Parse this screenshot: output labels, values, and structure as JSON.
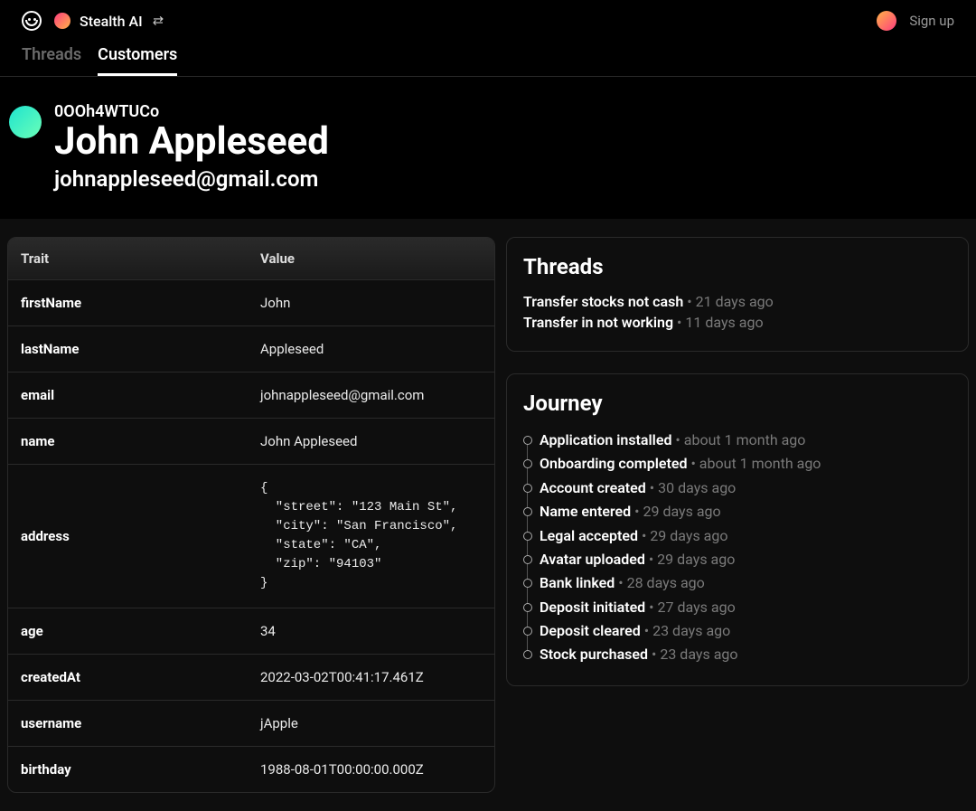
{
  "topbar": {
    "workspace_name": "Stealth AI",
    "signup_label": "Sign up"
  },
  "tabs": {
    "threads": "Threads",
    "customers": "Customers"
  },
  "customer": {
    "id": "0OOh4WTUCo",
    "name": "John Appleseed",
    "email": "johnappleseed@gmail.com"
  },
  "traits_table": {
    "header_trait": "Trait",
    "header_value": "Value",
    "rows": [
      {
        "trait": "firstName",
        "value": "John"
      },
      {
        "trait": "lastName",
        "value": "Appleseed"
      },
      {
        "trait": "email",
        "value": "johnappleseed@gmail.com"
      },
      {
        "trait": "name",
        "value": "John Appleseed"
      },
      {
        "trait": "address",
        "value": "{\n  \"street\": \"123 Main St\",\n  \"city\": \"San Francisco\",\n  \"state\": \"CA\",\n  \"zip\": \"94103\"\n}",
        "mono": true
      },
      {
        "trait": "age",
        "value": "34"
      },
      {
        "trait": "createdAt",
        "value": "2022-03-02T00:41:17.461Z"
      },
      {
        "trait": "username",
        "value": "jApple"
      },
      {
        "trait": "birthday",
        "value": "1988-08-01T00:00:00.000Z"
      }
    ]
  },
  "threads_card": {
    "title": "Threads",
    "items": [
      {
        "title": "Transfer stocks not cash",
        "meta": " • 21 days ago"
      },
      {
        "title": "Transfer in not working",
        "meta": " • 11 days ago"
      }
    ]
  },
  "journey_card": {
    "title": "Journey",
    "items": [
      {
        "title": "Application installed",
        "meta": " • about 1 month ago"
      },
      {
        "title": "Onboarding completed",
        "meta": " • about 1 month ago"
      },
      {
        "title": "Account created",
        "meta": " • 30 days ago"
      },
      {
        "title": "Name entered",
        "meta": " • 29 days ago"
      },
      {
        "title": "Legal accepted",
        "meta": " • 29 days ago"
      },
      {
        "title": "Avatar uploaded",
        "meta": " • 29 days ago"
      },
      {
        "title": "Bank linked",
        "meta": " • 28 days ago"
      },
      {
        "title": "Deposit initiated",
        "meta": " • 27 days ago"
      },
      {
        "title": "Deposit cleared",
        "meta": " • 23 days ago"
      },
      {
        "title": "Stock purchased",
        "meta": " • 23 days ago"
      }
    ]
  }
}
